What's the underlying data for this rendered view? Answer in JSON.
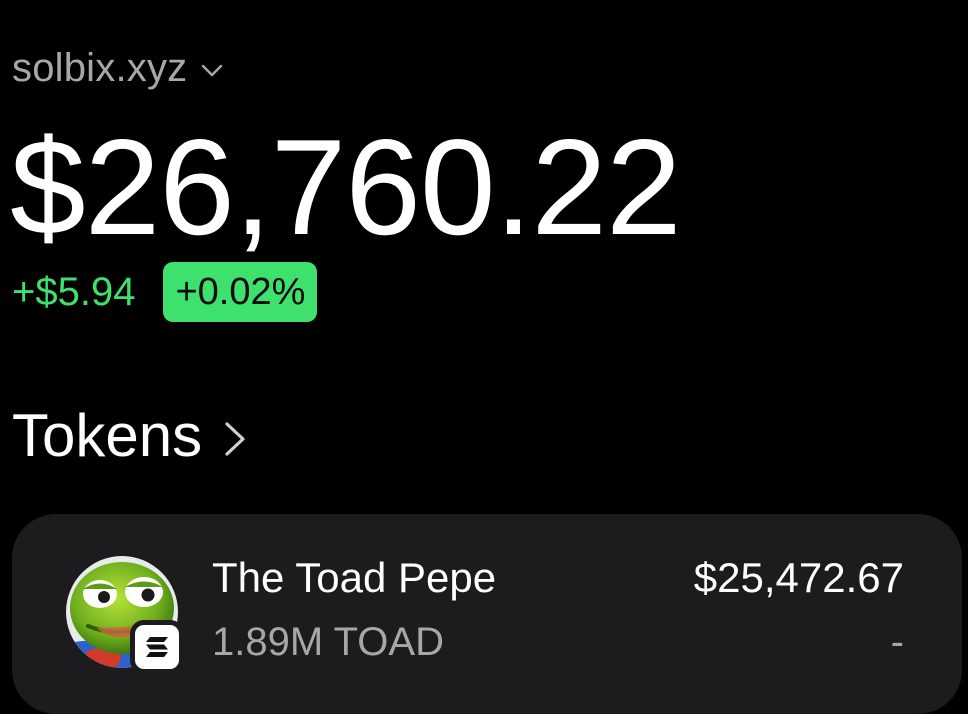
{
  "account": {
    "name": "solbix.xyz",
    "icon": "chevron-down-icon"
  },
  "portfolio": {
    "balance": "$26,760.22",
    "change_amount": "+$5.94",
    "change_percent": "+0.02%"
  },
  "tokens_section": {
    "title": "Tokens",
    "icon": "chevron-right-icon"
  },
  "tokens": [
    {
      "name": "The Toad Pepe",
      "amount": "1.89M TOAD",
      "value": "$25,472.67",
      "change": "-",
      "avatar_icon": "toad-pepe-avatar",
      "chain_icon": "solana-icon"
    }
  ],
  "colors": {
    "background": "#000000",
    "card": "#1c1c1e",
    "positive": "#3ee06e",
    "muted_text": "#a7a7a7",
    "text": "#ffffff"
  }
}
